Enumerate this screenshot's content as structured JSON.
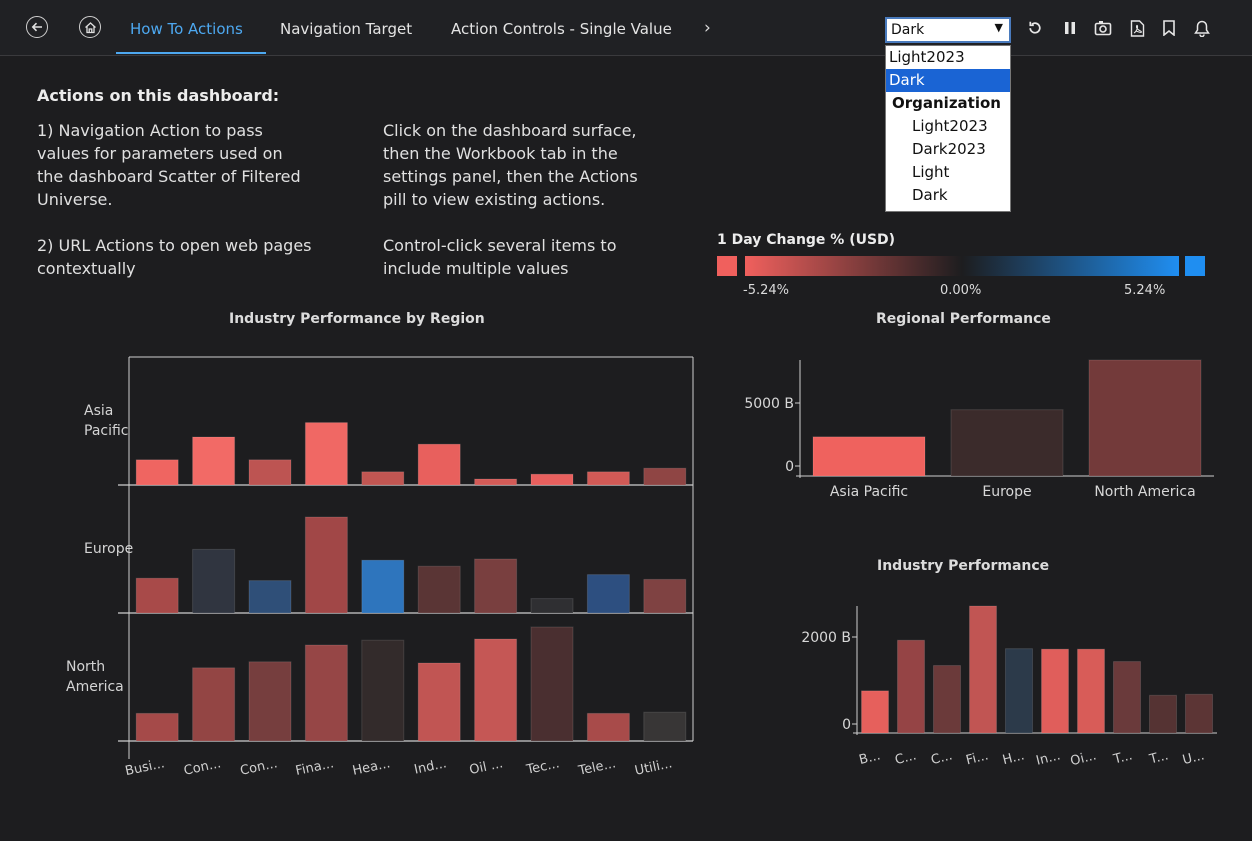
{
  "toolbar": {
    "tabs": [
      "How To Actions",
      "Navigation Target",
      "Action Controls - Single Value"
    ],
    "theme_select": {
      "value": "Dark",
      "options": [
        {
          "label": "Light2023",
          "kind": "option"
        },
        {
          "label": "Dark",
          "kind": "selected"
        },
        {
          "label": "Organization",
          "kind": "group"
        },
        {
          "label": "Light2023",
          "kind": "indented"
        },
        {
          "label": "Dark2023",
          "kind": "indented"
        },
        {
          "label": "Light",
          "kind": "indented"
        },
        {
          "label": "Dark",
          "kind": "indented"
        }
      ]
    },
    "icons": [
      "back-icon",
      "home-icon",
      "chevron-right-icon",
      "refresh-icon",
      "pause-icon",
      "camera-icon",
      "pdf-icon",
      "bookmark-icon",
      "bell-icon"
    ]
  },
  "text_panel": {
    "heading": "Actions on this dashboard:",
    "left_lines": [
      "1) Navigation Action to pass",
      "values for parameters used on",
      "the dashboard Scatter of Filtered",
      "Universe.",
      "",
      "2) URL Actions to open web pages",
      "contextually"
    ],
    "right_lines": [
      "Click on the dashboard surface,",
      "then the Workbook tab in the",
      "settings panel, then the Actions",
      "pill to view existing actions.",
      "",
      "Control-click several items to",
      "include multiple values"
    ]
  },
  "legend": {
    "title": "1 Day Change % (USD)",
    "min_label": "-5.24%",
    "mid_label": "0.00%",
    "max_label": "5.24%",
    "colors": {
      "negative": "#f0605d",
      "neutral": "#1d1d1f",
      "positive": "#1f8ef1"
    }
  },
  "chart_data": [
    {
      "type": "bar",
      "title": "Industry Performance by Region",
      "facets": [
        "Asia Pacific",
        "Europe",
        "North America"
      ],
      "categories": [
        "Busi...",
        "Con...",
        "Con...",
        "Fina...",
        "Hea...",
        "Ind...",
        "Oil ...",
        "Tec...",
        "Tele...",
        "Utili..."
      ],
      "series": [
        {
          "values": [
            21,
            40,
            21,
            52,
            11,
            34,
            5,
            9,
            11,
            14
          ],
          "colors": [
            "#ef6561",
            "#f26a66",
            "#bd5452",
            "#f06864",
            "#c15652",
            "#e8605d",
            "#d35b57",
            "#e8605e",
            "#d15a56",
            "#8f4544"
          ]
        },
        {
          "values": [
            29,
            53,
            27,
            80,
            44,
            39,
            45,
            12,
            32,
            28
          ],
          "colors": [
            "#a84a49",
            "#303540",
            "#2f4f78",
            "#a14747",
            "#2e75bd",
            "#5a3535",
            "#793f3f",
            "#2f2f32",
            "#2d4f80",
            "#7f4242"
          ]
        },
        {
          "values": [
            23,
            61,
            66,
            80,
            84,
            65,
            85,
            95,
            23,
            24
          ],
          "colors": [
            "#a54a49",
            "#934544",
            "#763e3e",
            "#964646",
            "#332b2b",
            "#c15553",
            "#c55755",
            "#4a2f30",
            "#a84b4a",
            "#383636"
          ]
        }
      ]
    },
    {
      "type": "bar",
      "title": "Regional Performance",
      "categories": [
        "Asia Pacific",
        "Europe",
        "North America"
      ],
      "values": [
        2600,
        4400,
        7700
      ],
      "colors": [
        "#ef625e",
        "#3b2b2b",
        "#733a3a"
      ],
      "yticks": [
        "5000 B",
        "0"
      ]
    },
    {
      "type": "bar",
      "title": "Industry Performance",
      "categories": [
        "B...",
        "C...",
        "C...",
        "Fi...",
        "H...",
        "In...",
        "Oi...",
        "T...",
        "T...",
        "U..."
      ],
      "values": [
        850,
        1870,
        1360,
        2560,
        1700,
        1690,
        1690,
        1440,
        760,
        780
      ],
      "colors": [
        "#e6605c",
        "#954445",
        "#6b3a3a",
        "#c15553",
        "#2c3a4a",
        "#e05e5b",
        "#d85c58",
        "#6a3a3b",
        "#553333",
        "#5c3535"
      ],
      "yticks": [
        "2000 B",
        "0"
      ]
    }
  ]
}
